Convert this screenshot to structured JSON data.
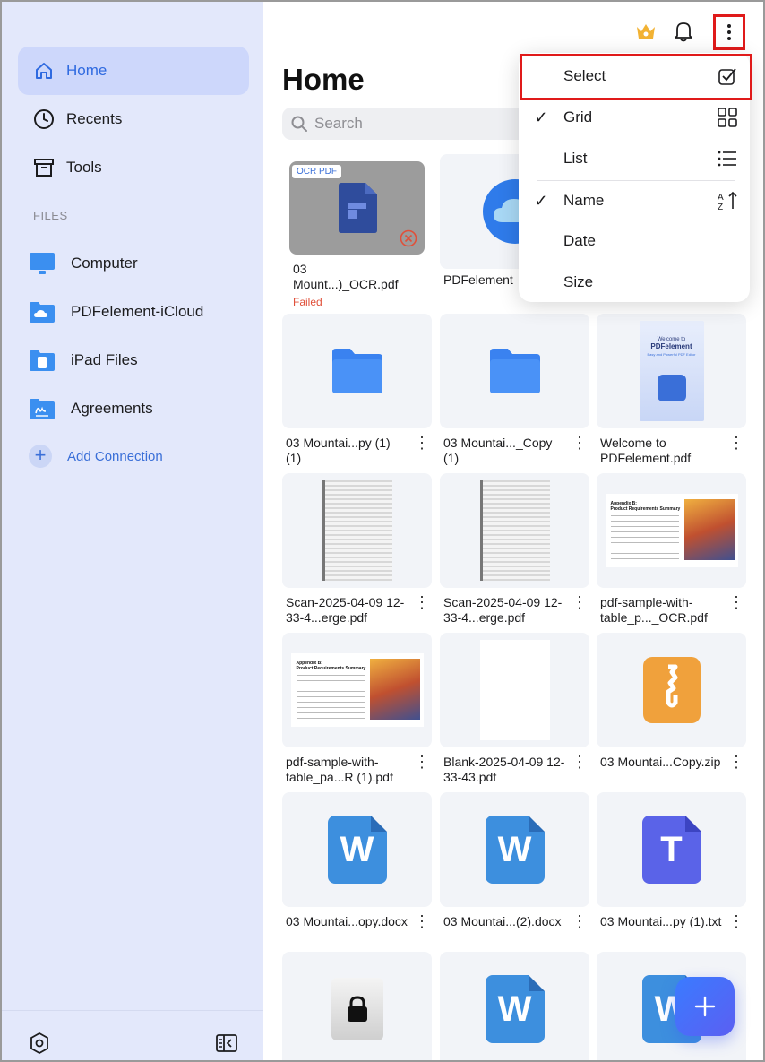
{
  "sidebar": {
    "nav": [
      {
        "label": "Home",
        "active": true,
        "icon": "house-icon"
      },
      {
        "label": "Recents",
        "active": false,
        "icon": "clock-icon"
      },
      {
        "label": "Tools",
        "active": false,
        "icon": "archive-box-icon"
      }
    ],
    "files_heading": "FILES",
    "folders": [
      {
        "label": "Computer",
        "icon": "monitor-icon"
      },
      {
        "label": "PDFelement-iCloud",
        "icon": "cloud-folder-icon"
      },
      {
        "label": "iPad Files",
        "icon": "tablet-folder-icon"
      },
      {
        "label": "Agreements",
        "icon": "signature-folder-icon"
      }
    ],
    "add_connection": "Add Connection"
  },
  "main": {
    "title": "Home",
    "search_placeholder": "Search"
  },
  "files": [
    {
      "name": "03 Mount...)_OCR.pdf",
      "status": "Failed",
      "badge": "OCR PDF",
      "kind": "ocr-failed"
    },
    {
      "name": "PDFelement",
      "kind": "cloud"
    },
    {
      "name": "03 Mountai...py (1) (1)",
      "kind": "folder"
    },
    {
      "name": "03 Mountai..._Copy (1)",
      "kind": "folder"
    },
    {
      "name": "Welcome to PDFelement.pdf",
      "kind": "welcome",
      "thumb_title": "PDFelement",
      "thumb_sub": "Welcome to"
    },
    {
      "name": "Scan-2025-04-09 12-33-4...erge.pdf",
      "kind": "scan"
    },
    {
      "name": "Scan-2025-04-09 12-33-4...erge.pdf",
      "kind": "scan"
    },
    {
      "name": "pdf-sample-with-table_p..._OCR.pdf",
      "kind": "table"
    },
    {
      "name": "pdf-sample-with-table_pa...R (1).pdf",
      "kind": "table"
    },
    {
      "name": "Blank-2025-04-09 12-33-43.pdf",
      "kind": "blank"
    },
    {
      "name": "03 Mountai...Copy.zip",
      "kind": "zip"
    },
    {
      "name": "03 Mountai...opy.docx",
      "kind": "word",
      "glyph": "W"
    },
    {
      "name": "03 Mountai...(2).docx",
      "kind": "word",
      "glyph": "W"
    },
    {
      "name": "03 Mountai...py (1).txt",
      "kind": "txt",
      "glyph": "T"
    },
    {
      "name": "",
      "kind": "locked"
    },
    {
      "name": "",
      "kind": "word",
      "glyph": "W"
    },
    {
      "name": "",
      "kind": "word",
      "glyph": "W"
    }
  ],
  "menu": {
    "items": [
      {
        "label": "Select",
        "checked": false,
        "icon": "checkbox-icon"
      },
      {
        "label": "Grid",
        "checked": true,
        "icon": "grid-icon"
      },
      {
        "label": "List",
        "checked": false,
        "icon": "list-icon"
      },
      {
        "label": "Name",
        "checked": true,
        "icon": "sort-az-icon"
      },
      {
        "label": "Date",
        "checked": false,
        "icon": ""
      },
      {
        "label": "Size",
        "checked": false,
        "icon": ""
      }
    ],
    "check_glyph": "✓"
  },
  "colors": {
    "accent": "#2f6ae0",
    "sidebar_bg": "#e3e8fb",
    "highlight_red": "#e01a1a",
    "word_blue": "#3d8fde",
    "txt_purple": "#5a63e8",
    "zip_orange": "#f0a13c"
  },
  "thumb_text": {
    "welcome_sub": "Welcome to",
    "welcome_title": "PDFelement",
    "welcome_tag": "Easy and Powerful PDF Editor",
    "table_sub": "Appendix B:",
    "table_title": "Product Requirements Summary"
  }
}
